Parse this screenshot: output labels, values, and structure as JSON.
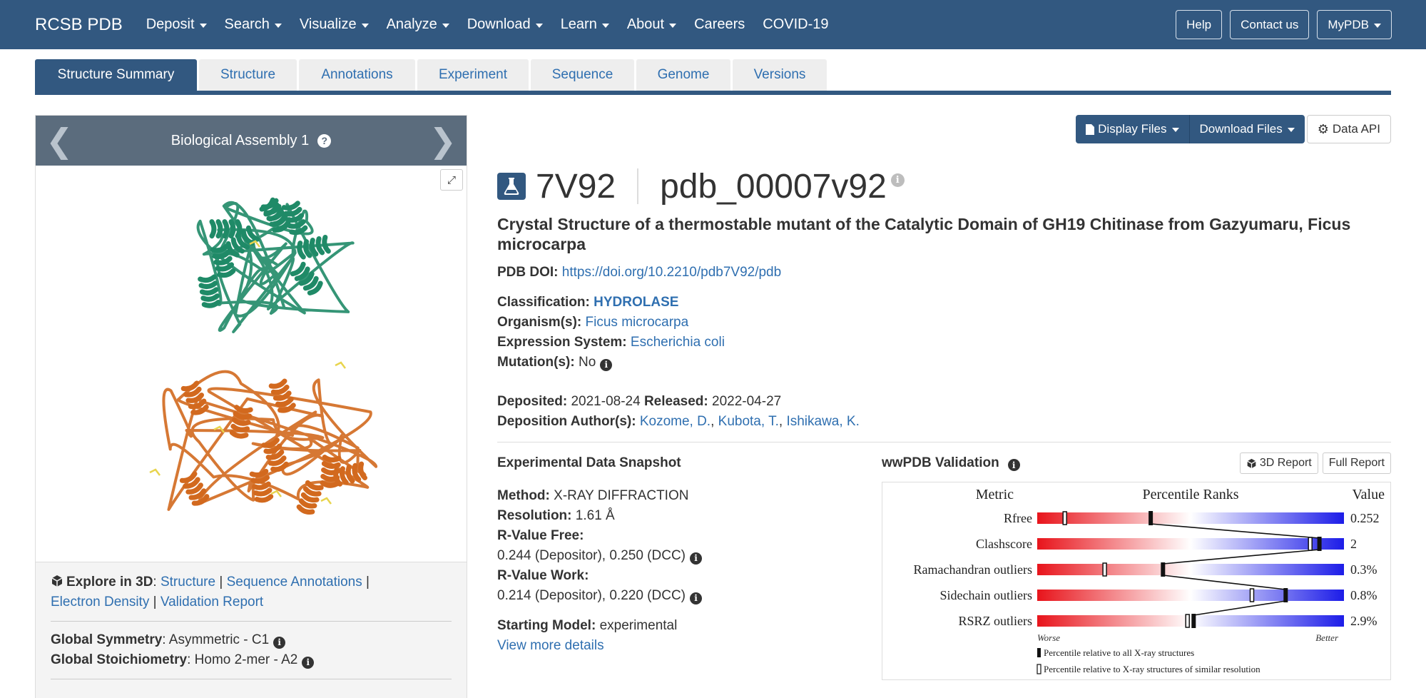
{
  "navbar": {
    "brand": "RCSB PDB",
    "items": [
      {
        "label": "Deposit",
        "dropdown": true
      },
      {
        "label": "Search",
        "dropdown": true
      },
      {
        "label": "Visualize",
        "dropdown": true
      },
      {
        "label": "Analyze",
        "dropdown": true
      },
      {
        "label": "Download",
        "dropdown": true
      },
      {
        "label": "Learn",
        "dropdown": true
      },
      {
        "label": "About",
        "dropdown": true
      },
      {
        "label": "Careers",
        "dropdown": false
      },
      {
        "label": "COVID-19",
        "dropdown": false
      }
    ],
    "help": "Help",
    "contact": "Contact us",
    "mypdb": "MyPDB"
  },
  "tabs": [
    {
      "label": "Structure Summary",
      "active": true
    },
    {
      "label": "Structure",
      "active": false
    },
    {
      "label": "Annotations",
      "active": false
    },
    {
      "label": "Experiment",
      "active": false
    },
    {
      "label": "Sequence",
      "active": false
    },
    {
      "label": "Genome",
      "active": false
    },
    {
      "label": "Versions",
      "active": false
    }
  ],
  "left_panel": {
    "assembly_title": "Biological Assembly 1",
    "explore_label": "Explore in 3D",
    "explore_links": [
      "Structure",
      "Sequence Annotations",
      "Electron Density",
      "Validation Report"
    ],
    "symmetry_label": "Global Symmetry",
    "symmetry_value": "Asymmetric - C1",
    "stoichiometry_label": "Global Stoichiometry",
    "stoichiometry_value": "Homo 2-mer - A2",
    "chain_colors": {
      "chain_a": "#1f8a67",
      "chain_b": "#d2691e"
    }
  },
  "file_buttons": {
    "display": "Display Files",
    "download": "Download Files",
    "api": "Data API"
  },
  "entry": {
    "id": "7V92",
    "extended_id": "pdb_00007v92",
    "title": "Crystal Structure of a thermostable mutant of the Catalytic Domain of GH19 Chitinase from Gazyumaru, Ficus microcarpa",
    "doi_label": "PDB DOI:",
    "doi": "https://doi.org/10.2210/pdb7V92/pdb",
    "classification_label": "Classification:",
    "classification": "HYDROLASE",
    "organism_label": "Organism(s):",
    "organism": "Ficus microcarpa",
    "expression_label": "Expression System:",
    "expression": "Escherichia coli",
    "mutation_label": "Mutation(s):",
    "mutation": "No",
    "deposited_label": "Deposited:",
    "deposited": "2021-08-24",
    "released_label": "Released:",
    "released": "2022-04-27",
    "authors_label": "Deposition Author(s):",
    "authors": [
      "Kozome, D.",
      "Kubota, T.",
      "Ishikawa, K."
    ]
  },
  "experimental": {
    "title": "Experimental Data Snapshot",
    "method_label": "Method:",
    "method": "X-RAY DIFFRACTION",
    "resolution_label": "Resolution:",
    "resolution": "1.61 Å",
    "rfree_label": "R-Value Free:",
    "rfree": "0.244 (Depositor), 0.250 (DCC)",
    "rwork_label": "R-Value Work:",
    "rwork": "0.214 (Depositor), 0.220 (DCC)",
    "model_label": "Starting Model:",
    "model": "experimental",
    "more": "View more details"
  },
  "validation": {
    "title": "wwPDB Validation",
    "btn_3d": "3D Report",
    "btn_full": "Full Report",
    "header_metric": "Metric",
    "header_ranks": "Percentile Ranks",
    "header_value": "Value",
    "worse": "Worse",
    "better": "Better",
    "legend_all": "Percentile relative to all X-ray structures",
    "legend_similar": "Percentile relative to X-ray structures of similar resolution",
    "metrics": [
      {
        "name": "Rfree",
        "value": "0.252",
        "all": 0.37,
        "similar": 0.09
      },
      {
        "name": "Clashscore",
        "value": "2",
        "all": 0.92,
        "similar": 0.89
      },
      {
        "name": "Ramachandran outliers",
        "value": "0.3%",
        "all": 0.41,
        "similar": 0.22
      },
      {
        "name": "Sidechain outliers",
        "value": "0.8%",
        "all": 0.81,
        "similar": 0.7
      },
      {
        "name": "RSRZ outliers",
        "value": "2.9%",
        "all": 0.51,
        "similar": 0.49
      }
    ],
    "gradient": {
      "worse": "#e8141b",
      "mid": "#ffffff",
      "better": "#1c1ce8"
    }
  }
}
